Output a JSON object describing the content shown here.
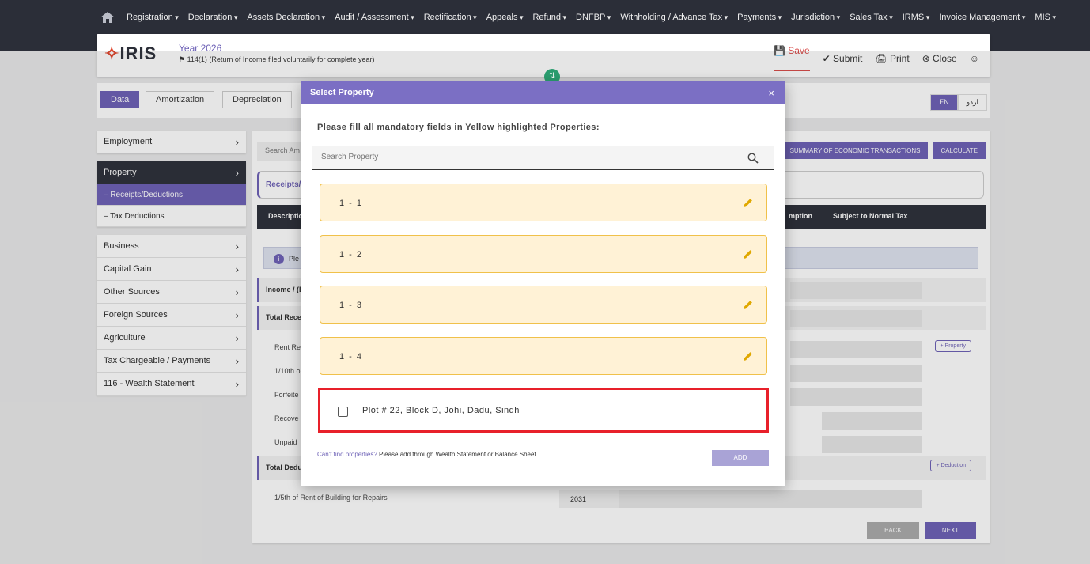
{
  "nav": {
    "items": [
      "Registration",
      "Declaration",
      "Assets Declaration",
      "Audit / Assessment",
      "Rectification",
      "Appeals",
      "Refund",
      "DNFBP",
      "Withholding / Advance Tax",
      "Payments",
      "Jurisdiction",
      "Sales Tax",
      "IRMS",
      "Invoice Management",
      "MIS"
    ]
  },
  "header": {
    "logo_mark": "✧",
    "logo_text": "IRIS",
    "year": "Year 2026",
    "return_type": "⚑ 114(1) (Return of Income filed voluntarily for complete year)",
    "save": "💾 Save",
    "submit": "✔ Submit",
    "print": "🖨 Print",
    "close": "⊗ Close",
    "user_icon": "☺"
  },
  "tabs": {
    "data": "Data",
    "amortization": "Amortization",
    "depreciation": "Depreciation"
  },
  "lang": {
    "en": "EN",
    "ur": "اردو"
  },
  "sidebar": {
    "employment": "Employment",
    "property": "Property",
    "receipts": "– Receipts/Deductions",
    "tax_deductions": "– Tax Deductions",
    "business": "Business",
    "capital_gain": "Capital Gain",
    "other_sources": "Other Sources",
    "foreign_sources": "Foreign Sources",
    "agriculture": "Agriculture",
    "tax_chargeable": "Tax Chargeable / Payments",
    "wealth": "116 - Wealth Statement"
  },
  "main": {
    "search_placeholder": "Search Am",
    "summary_btn": "SUMMARY OF ECONOMIC TRANSACTIONS",
    "calculate_btn": "CALCULATE",
    "card_title": "Receipts/",
    "th_description": "Descriptio",
    "th_exemption": "mption",
    "th_subject": "Subject to Normal Tax",
    "info_text": "Ple",
    "info_icon": "i",
    "row_income": "Income / (L",
    "row_total_receipts": "Total Recei",
    "row_rent": "Rent Re",
    "row_tenth": "1/10th o",
    "row_forfeited": "Forfeite",
    "row_recovered": "Recove",
    "row_unpaid": "Unpaid",
    "row_total_deductions": "Total Dedu",
    "row_fifth": "1/5th of Rent of Building for Repairs",
    "add_property": "+ Property",
    "add_deduction": "+ Deduction",
    "value_2031": "2031",
    "back": "BACK",
    "next": "NEXT"
  },
  "modal": {
    "title": "Select Property",
    "close": "×",
    "message": "Please fill all mandatory fields in Yellow highlighted Properties:",
    "search_placeholder": "Search Property",
    "properties": [
      "1 - 1",
      "1 - 2",
      "1 - 3",
      "1 - 4"
    ],
    "plot": "Plot # 22, Block D, Johi, Dadu, Sindh",
    "cant_find": "Can't find properties?",
    "hint": " Please add through Wealth Statement or Balance Sheet.",
    "add": "ADD"
  },
  "colors": {
    "accent": "#6b5fb5",
    "modal_header": "#7b6fc4",
    "warning_bg": "#fff2d6",
    "warning_border": "#f0c14a",
    "highlight": "#e8202a"
  }
}
